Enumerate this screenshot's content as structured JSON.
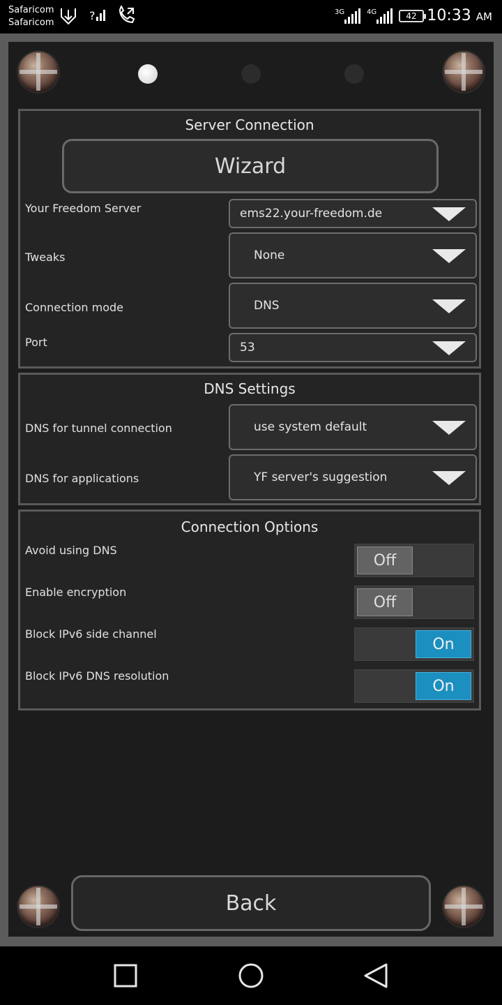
{
  "status_bar": {
    "carrier_1": "Safaricom",
    "carrier_2": "Safaricom",
    "network_1": "3G",
    "network_2": "4G",
    "battery": "42",
    "time": "10:33",
    "ampm": "AM"
  },
  "pager": {
    "pages": 3,
    "active_page": 1
  },
  "server_connection": {
    "title": "Server Connection",
    "wizard_label": "Wizard",
    "rows": [
      {
        "label": "Your Freedom Server",
        "value": "ems22.your-freedom.de"
      },
      {
        "label": "Tweaks",
        "value": "None"
      },
      {
        "label": "Connection mode",
        "value": "DNS"
      },
      {
        "label": "Port",
        "value": "53"
      }
    ]
  },
  "dns_settings": {
    "title": "DNS Settings",
    "rows": [
      {
        "label": "DNS for tunnel connection",
        "value": "use system default"
      },
      {
        "label": "DNS for applications",
        "value": "YF server's suggestion"
      }
    ]
  },
  "connection_options": {
    "title": "Connection Options",
    "rows": [
      {
        "label": "Avoid using DNS",
        "state": "Off"
      },
      {
        "label": "Enable encryption",
        "state": "Off"
      },
      {
        "label": "Block IPv6 side channel",
        "state": "On"
      },
      {
        "label": "Block IPv6 DNS resolution",
        "state": "On"
      }
    ]
  },
  "back_label": "Back",
  "colors": {
    "toggle_on": "#1b8fbf",
    "toggle_off": "#636363",
    "panel": "#1c1c1c"
  }
}
